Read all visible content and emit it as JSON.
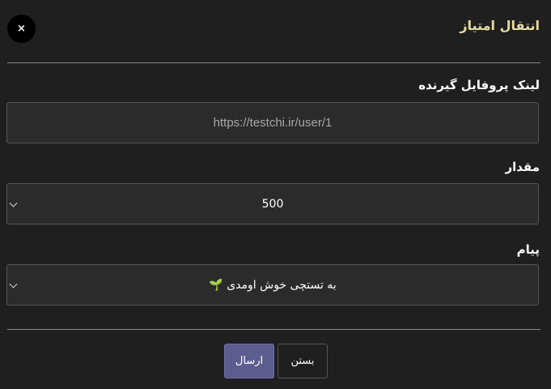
{
  "modal": {
    "title": "انتقال امتیاز",
    "close_icon": "×"
  },
  "form": {
    "receiver_link_label": "لینک پروفایل گیرنده",
    "receiver_link_placeholder": "https://testchi.ir/user/1",
    "amount_label": "مقدار",
    "amount_value": "500",
    "message_label": "پیام",
    "message_value": "به تستچی خوش اومدی 🌱"
  },
  "footer": {
    "send_label": "ارسال",
    "close_label": "بستن"
  },
  "colors": {
    "title": "#e7dca5",
    "send_button": "#5c5d8f",
    "background": "#1f1f1f"
  }
}
